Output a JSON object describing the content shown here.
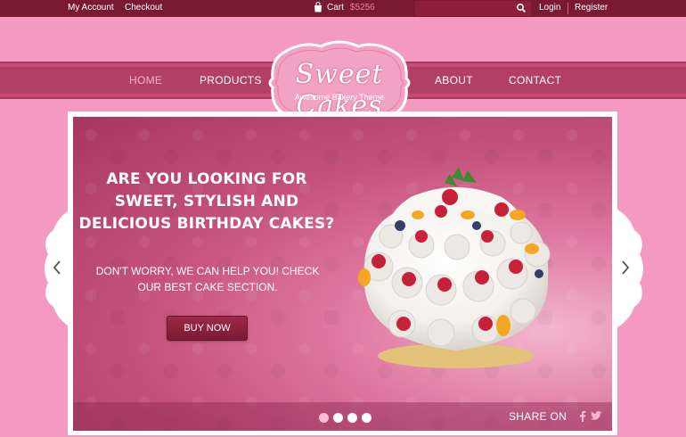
{
  "topbar": {
    "my_account": "My Account",
    "checkout": "Checkout",
    "cart_label": "Cart",
    "cart_amount": "$5256",
    "login": "Login",
    "register": "Register",
    "search_icon": "search-icon",
    "cart_icon": "shopping-bag-icon"
  },
  "nav": {
    "home": "HOME",
    "products": "PRODUCTS",
    "about": "ABOUT",
    "contact": "CONTACT"
  },
  "logo": {
    "title": "Sweet Cakes",
    "subtitle": "Awesome Bakery Theme"
  },
  "slide": {
    "headline_1": "ARE YOU LOOKING FOR",
    "headline_2": "SWEET, STYLISH AND",
    "headline_3": "DELICIOUS BIRTHDAY CAKES?",
    "sub_1": "DON'T WORRY, WE CAN HELP YOU! CHECK",
    "sub_2": "OUR BEST CAKE SECTION.",
    "buy_label": "BUY NOW",
    "share_label": "SHARE ON",
    "active_dot": 2,
    "dot_count": 4
  },
  "colors": {
    "page_bg": "#f49ac1",
    "topbar_bg": "#7a1a30",
    "navbar_bg": "#b13f66",
    "accent": "#ee7fa3",
    "button_bg": "#8a2240"
  }
}
